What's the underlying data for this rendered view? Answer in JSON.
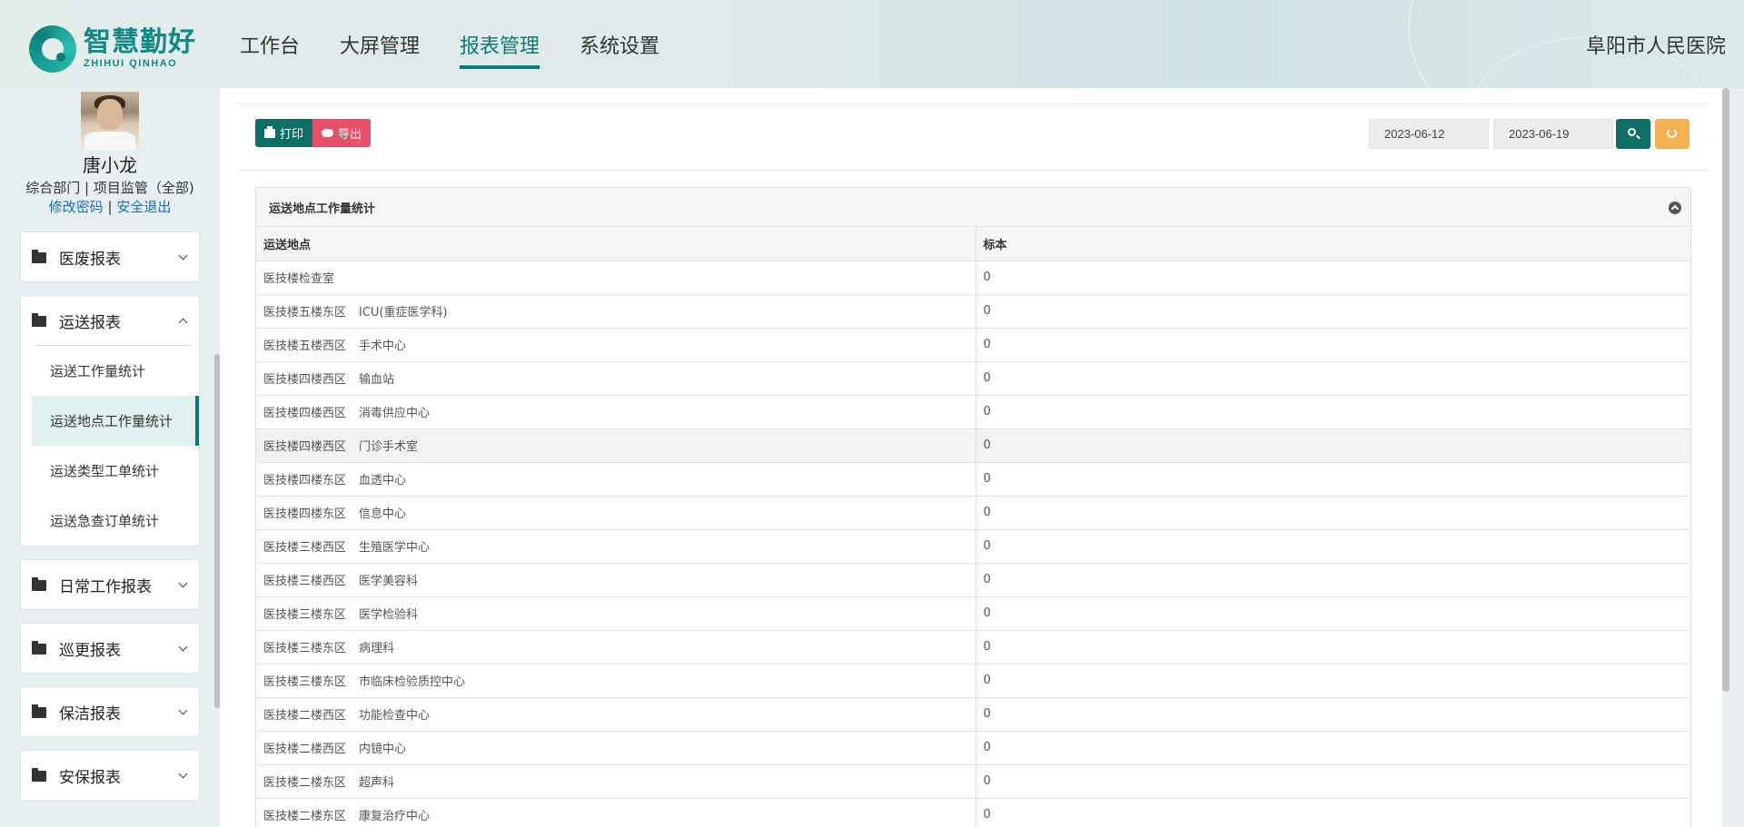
{
  "brand": {
    "name_cn": "智慧勤好",
    "name_en": "ZHIHUI QINHAO"
  },
  "nav": {
    "items": [
      "工作台",
      "大屏管理",
      "报表管理",
      "系统设置"
    ],
    "active": "报表管理"
  },
  "hospital": "阜阳市人民医院",
  "user": {
    "name": "唐小龙",
    "dept": "综合部门 | 项目监管（全部)",
    "change_password": "修改密码",
    "separator": "|",
    "logout": "安全退出"
  },
  "menu": {
    "groups": [
      {
        "title": "医废报表"
      },
      {
        "title": "运送报表",
        "expanded": true,
        "items": [
          "运送工作量统计",
          "运送地点工作量统计",
          "运送类型工单统计",
          "运送急查订单统计"
        ],
        "active_item": "运送地点工作量统计"
      },
      {
        "title": "日常工作报表"
      },
      {
        "title": "巡更报表"
      },
      {
        "title": "保洁报表"
      },
      {
        "title": "安保报表"
      }
    ]
  },
  "toolbar": {
    "print_label": "打印",
    "export_label": "导出"
  },
  "filter": {
    "start_date": "2023-06-12",
    "end_date": "2023-06-19"
  },
  "report": {
    "title": "运送地点工作量统计",
    "columns": [
      "运送地点",
      "标本"
    ],
    "rows": [
      {
        "a": "医技楼检查室",
        "b": "",
        "v": "0"
      },
      {
        "a": "医技楼五楼东区",
        "b": "ICU(重症医学科)",
        "v": "0"
      },
      {
        "a": "医技楼五楼西区",
        "b": "手术中心",
        "v": "0"
      },
      {
        "a": "医技楼四楼西区",
        "b": "输血站",
        "v": "0"
      },
      {
        "a": "医技楼四楼西区",
        "b": "消毒供应中心",
        "v": "0"
      },
      {
        "a": "医技楼四楼西区",
        "b": "门诊手术室",
        "v": "0"
      },
      {
        "a": "医技楼四楼东区",
        "b": "血透中心",
        "v": "0"
      },
      {
        "a": "医技楼四楼东区",
        "b": "信息中心",
        "v": "0"
      },
      {
        "a": "医技楼三楼西区",
        "b": "生殖医学中心",
        "v": "0"
      },
      {
        "a": "医技楼三楼西区",
        "b": "医学美容科",
        "v": "0"
      },
      {
        "a": "医技楼三楼东区",
        "b": "医学检验科",
        "v": "0"
      },
      {
        "a": "医技楼三楼东区",
        "b": "病理科",
        "v": "0"
      },
      {
        "a": "医技楼三楼东区",
        "b": "市临床检验质控中心",
        "v": "0"
      },
      {
        "a": "医技楼二楼西区",
        "b": "功能检查中心",
        "v": "0"
      },
      {
        "a": "医技楼二楼西区",
        "b": "内镜中心",
        "v": "0"
      },
      {
        "a": "医技楼二楼东区",
        "b": "超声科",
        "v": "0"
      },
      {
        "a": "医技楼二楼东区",
        "b": "康复治疗中心",
        "v": "0"
      }
    ]
  },
  "colors": {
    "primary": "#0e7a74",
    "export": "#e8506a",
    "reset": "#f5b04f"
  }
}
